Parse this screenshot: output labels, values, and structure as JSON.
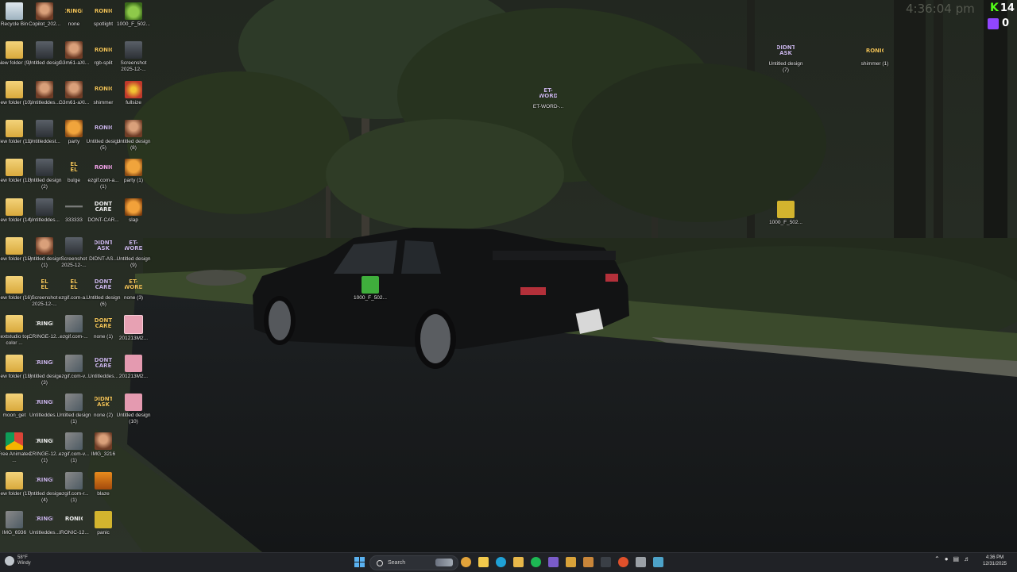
{
  "desktop": {
    "columns": [
      [
        {
          "label": "Recycle Bin",
          "icon": "recycle-bin-icon",
          "style": "t-recycle",
          "glyph": ""
        },
        {
          "label": "New folder (9)",
          "icon": "folder-icon",
          "style": "t-folder",
          "glyph": ""
        },
        {
          "label": "New folder (10)",
          "icon": "folder-icon",
          "style": "t-folder",
          "glyph": ""
        },
        {
          "label": "New folder (11)",
          "icon": "folder-icon",
          "style": "t-folder",
          "glyph": ""
        },
        {
          "label": "New folder (12)",
          "icon": "folder-icon",
          "style": "t-folder",
          "glyph": ""
        },
        {
          "label": "New folder (14)",
          "icon": "folder-icon",
          "style": "t-folder",
          "glyph": ""
        },
        {
          "label": "New folder (15)",
          "icon": "folder-icon",
          "style": "t-folder",
          "glyph": ""
        },
        {
          "label": "New folder (16)",
          "icon": "folder-icon",
          "style": "t-folder",
          "glyph": ""
        },
        {
          "label": "textstudio top color ...",
          "icon": "folder-icon",
          "style": "t-folder",
          "glyph": ""
        },
        {
          "label": "New folder (13)",
          "icon": "folder-icon",
          "style": "t-folder",
          "glyph": ""
        },
        {
          "label": "moon_get",
          "icon": "folder-icon",
          "style": "t-folder",
          "glyph": ""
        },
        {
          "label": "Free Animated ...",
          "icon": "chrome-shortcut-icon",
          "style": "t-chrome",
          "glyph": ""
        },
        {
          "label": "New folder (17)",
          "icon": "folder-icon",
          "style": "t-folder",
          "glyph": ""
        },
        {
          "label": "IMG_6936",
          "icon": "photo-icon",
          "style": "t-photo",
          "glyph": ""
        }
      ],
      [
        {
          "label": "Copilot_202...",
          "icon": "image-file-icon",
          "style": "t-photo-man",
          "glyph": ""
        },
        {
          "label": "Untitled design",
          "icon": "image-file-icon",
          "style": "t-car",
          "glyph": ""
        },
        {
          "label": "Untitleddes...",
          "icon": "image-file-icon",
          "style": "t-photo-man",
          "glyph": ""
        },
        {
          "label": "Untitleddest...",
          "icon": "image-file-icon",
          "style": "t-car",
          "glyph": ""
        },
        {
          "label": "Untitled design (2)",
          "icon": "image-file-icon",
          "style": "t-car",
          "glyph": ""
        },
        {
          "label": "Untitleddes...",
          "icon": "image-file-icon",
          "style": "t-car",
          "glyph": ""
        },
        {
          "label": "Untitled design (1)",
          "icon": "image-file-icon",
          "style": "t-photo-man",
          "glyph": ""
        },
        {
          "label": "Screenshot 2025-12-...",
          "icon": "gif-file-icon",
          "style": "t-text-gold",
          "glyph": "EL\nEL"
        },
        {
          "label": "CRINGE-12...",
          "icon": "gif-file-icon",
          "style": "t-text-white",
          "glyph": "CRINGE"
        },
        {
          "label": "Untitled design (3)",
          "icon": "gif-file-icon",
          "style": "t-text-purple",
          "glyph": "CRINGE"
        },
        {
          "label": "Untitleddes...",
          "icon": "gif-file-icon",
          "style": "t-text-purple",
          "glyph": "CRINGE"
        },
        {
          "label": "CRINGE-12... (1)",
          "icon": "gif-file-icon",
          "style": "t-text-white",
          "glyph": "CRINGE"
        },
        {
          "label": "Untitled design (4)",
          "icon": "gif-file-icon",
          "style": "t-text-purple",
          "glyph": "CRINGE"
        },
        {
          "label": "Untitleddes...",
          "icon": "gif-file-icon",
          "style": "t-text-purple",
          "glyph": "CRINGE"
        }
      ],
      [
        {
          "label": "none",
          "icon": "gif-file-icon",
          "style": "t-text-gold",
          "glyph": "CRINGE"
        },
        {
          "label": "G3m61-aXl...",
          "icon": "image-file-icon",
          "style": "t-photo-man",
          "glyph": ""
        },
        {
          "label": "G3m61-aXl...",
          "icon": "image-file-icon",
          "style": "t-photo-man",
          "glyph": ""
        },
        {
          "label": "party",
          "icon": "gif-file-icon",
          "style": "t-orange-face",
          "glyph": ""
        },
        {
          "label": "bulge",
          "icon": "gif-file-icon",
          "style": "t-text-gold",
          "glyph": "EL\nEL"
        },
        {
          "label": "333333",
          "icon": "image-file-icon",
          "style": "t-dark-line",
          "glyph": ""
        },
        {
          "label": "Screenshot 2025-12-...",
          "icon": "image-file-icon",
          "style": "t-car",
          "glyph": ""
        },
        {
          "label": "ezgif.com-a...",
          "icon": "gif-file-icon",
          "style": "t-text-gold",
          "glyph": "EL\nEL"
        },
        {
          "label": "ezgif.com-...",
          "icon": "image-file-icon",
          "style": "t-photo",
          "glyph": ""
        },
        {
          "label": "ezgif.com-v...",
          "icon": "image-file-icon",
          "style": "t-photo",
          "glyph": ""
        },
        {
          "label": "Untitled design (1)",
          "icon": "image-file-icon",
          "style": "t-photo",
          "glyph": ""
        },
        {
          "label": "ezgif.com-v... (1)",
          "icon": "image-file-icon",
          "style": "t-photo",
          "glyph": ""
        },
        {
          "label": "ezgif.com-r... (1)",
          "icon": "image-file-icon",
          "style": "t-photo",
          "glyph": ""
        },
        {
          "label": "IRONIC-12...",
          "icon": "gif-file-icon",
          "style": "t-text-white",
          "glyph": "IRONIC"
        }
      ],
      [
        {
          "label": "spotlight",
          "icon": "gif-file-icon",
          "style": "t-text-gold",
          "glyph": "IRONIC"
        },
        {
          "label": "rgb-split",
          "icon": "gif-file-icon",
          "style": "t-text-gold",
          "glyph": "IRONIC"
        },
        {
          "label": "shimmer",
          "icon": "gif-file-icon",
          "style": "t-text-gold",
          "glyph": "IRONIC"
        },
        {
          "label": "Untitled design (5)",
          "icon": "gif-file-icon",
          "style": "t-text-purple",
          "glyph": "IRONIC"
        },
        {
          "label": "ezgif.com-a... (1)",
          "icon": "gif-file-icon",
          "style": "t-text-pink",
          "glyph": "IRONIC"
        },
        {
          "label": "DONT-CAR...",
          "icon": "gif-file-icon",
          "style": "t-text-white",
          "glyph": "DONT\nCARE"
        },
        {
          "label": "DIDNT-AS...",
          "icon": "gif-file-icon",
          "style": "t-text-purple",
          "glyph": "DIDNT\nASK"
        },
        {
          "label": "Untitled design (6)",
          "icon": "gif-file-icon",
          "style": "t-text-purple",
          "glyph": "DONT\nCARE"
        },
        {
          "label": "none (1)",
          "icon": "gif-file-icon",
          "style": "t-text-gold",
          "glyph": "DONT\nCARE"
        },
        {
          "label": "Untitleddes...",
          "icon": "gif-file-icon",
          "style": "t-text-purple",
          "glyph": "DONT\nCARE"
        },
        {
          "label": "none (2)",
          "icon": "gif-file-icon",
          "style": "t-text-gold",
          "glyph": "DIDNT\nASK"
        },
        {
          "label": "IMG_3216",
          "icon": "photo-icon",
          "style": "t-photo-man",
          "glyph": ""
        },
        {
          "label": "blaze",
          "icon": "gif-file-icon",
          "style": "t-blaze",
          "glyph": ""
        },
        {
          "label": "panic",
          "icon": "gif-file-icon",
          "style": "t-pac",
          "glyph": ""
        }
      ],
      [
        {
          "label": "1000_F_502...",
          "icon": "frog-image-icon",
          "style": "t-frog",
          "glyph": ""
        },
        {
          "label": "Screenshot 2025-12-...",
          "icon": "image-file-icon",
          "style": "t-car",
          "glyph": ""
        },
        {
          "label": "fullsize",
          "icon": "gif-file-icon",
          "style": "t-fire",
          "glyph": ""
        },
        {
          "label": "Untitled design (8)",
          "icon": "image-file-icon",
          "style": "t-photo-man",
          "glyph": ""
        },
        {
          "label": "party (1)",
          "icon": "gif-file-icon",
          "style": "t-orange-face",
          "glyph": ""
        },
        {
          "label": "slap",
          "icon": "gif-file-icon",
          "style": "t-slap",
          "glyph": ""
        },
        {
          "label": "Untitled design (9)",
          "icon": "gif-file-icon",
          "style": "t-text-purple",
          "glyph": "ET-\nWORD"
        },
        {
          "label": "none (3)",
          "icon": "gif-file-icon",
          "style": "t-text-gold",
          "glyph": "ET-\nWORD"
        },
        {
          "label": "201213M2...",
          "icon": "image-file-icon",
          "style": "t-pink",
          "glyph": ""
        },
        {
          "label": "201213M2...",
          "icon": "image-file-icon",
          "style": "t-pink-shorts",
          "glyph": ""
        },
        {
          "label": "Untitled design (10)",
          "icon": "image-file-icon",
          "style": "t-pink-shorts",
          "glyph": ""
        }
      ]
    ],
    "floating": [
      {
        "label": "1000_F_502...",
        "icon": "frog-image-icon",
        "style": "t-frog-box",
        "glyph": ""
      },
      {
        "label": "ET-WORD-...",
        "icon": "gif-file-icon",
        "style": "t-text-purple",
        "glyph": "ET-\nWORD"
      },
      {
        "label": "Untitled design (7)",
        "icon": "gif-file-icon",
        "style": "t-text-purple",
        "glyph": "DIDNT\nASK"
      },
      {
        "label": "shimmer (1)",
        "icon": "gif-file-icon",
        "style": "t-text-gold",
        "glyph": "IRONIC"
      },
      {
        "label": "1000_F_502...",
        "icon": "frog-image-icon",
        "style": "t-pac",
        "glyph": ""
      }
    ]
  },
  "overlay": {
    "clock": "4:36:04 pm",
    "kick_count": "14",
    "twitch_count": "0"
  },
  "taskbar": {
    "weather_temp": "58°F",
    "weather_desc": "Windy",
    "search_placeholder": "Search",
    "time": "4:36 PM",
    "date": "12/31/2025",
    "apps": [
      {
        "name": "chrome-icon",
        "color": "#e2a33a"
      },
      {
        "name": "file-explorer-icon",
        "color": "#f2c94c"
      },
      {
        "name": "edge-icon",
        "color": "#1fa1d6"
      },
      {
        "name": "folder-icon",
        "color": "#e8b84a"
      },
      {
        "name": "spotify-icon",
        "color": "#1db954"
      },
      {
        "name": "app-icon",
        "color": "#7a5cc9"
      },
      {
        "name": "shield-icon",
        "color": "#d9a33a"
      },
      {
        "name": "photos-icon",
        "color": "#c9863a"
      },
      {
        "name": "terminal-icon",
        "color": "#3a3f46"
      },
      {
        "name": "brave-icon",
        "color": "#e0512b"
      },
      {
        "name": "settings-icon",
        "color": "#9aa0a6"
      },
      {
        "name": "app-icon",
        "color": "#4da3c9"
      }
    ]
  }
}
